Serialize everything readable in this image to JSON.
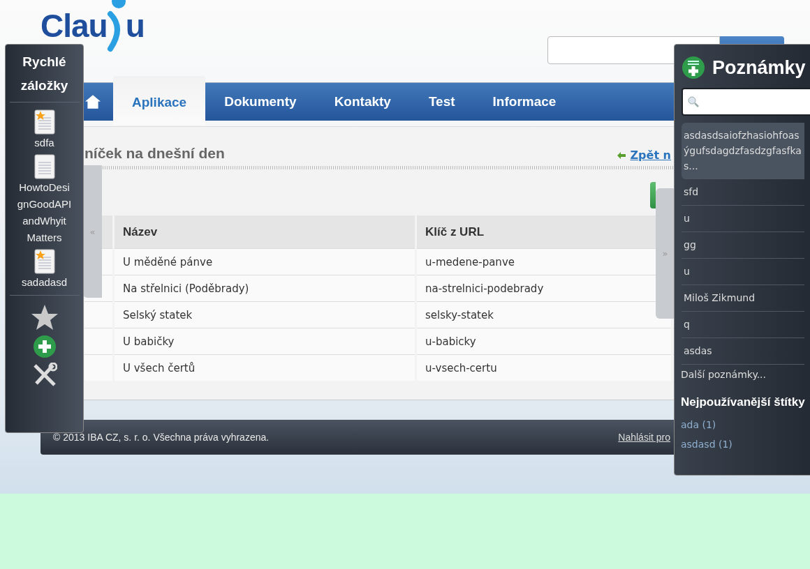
{
  "logo": {
    "text_1": "Clau",
    "text_2": "u"
  },
  "nav": {
    "tabs": [
      {
        "kind": "home",
        "selected": false
      },
      {
        "kind": "text",
        "label": "Aplikace",
        "selected": true
      },
      {
        "kind": "text",
        "label": "Dokumenty",
        "selected": false
      },
      {
        "kind": "text",
        "label": "Kontakty",
        "selected": false
      },
      {
        "kind": "text",
        "label": "Test",
        "selected": false
      },
      {
        "kind": "text",
        "label": "Informace",
        "selected": false
      }
    ]
  },
  "content": {
    "title": "níček na dnešní den",
    "back_link": "Zpět n",
    "scroll_left": "«",
    "scroll_right": "»",
    "table": {
      "columns": [
        "Název",
        "Klíč z URL"
      ],
      "rows": [
        [
          "U měděné pánve",
          "u-medene-panve"
        ],
        [
          "Na střelnici (Poděbrady)",
          "na-strelnici-podebrady"
        ],
        [
          "Selský statek",
          "selsky-statek"
        ],
        [
          "U babičky",
          "u-babicky"
        ],
        [
          "U všech čertů",
          "u-vsech-certu"
        ]
      ]
    }
  },
  "footer": {
    "copyright": "© 2013 IBA CZ, s. r. o. Všechna práva vyhrazena.",
    "report_link": "Nahlásit pro"
  },
  "quick_bookmarks": {
    "title": "Rychlé záložky",
    "items": [
      {
        "label": "sdfa",
        "starred": true
      },
      {
        "label": "HowtoDesignGoodAPIandWhyit Matters",
        "starred": false
      },
      {
        "label": "sadadasd",
        "starred": true
      }
    ]
  },
  "notes": {
    "title": "Poznámky",
    "items": [
      {
        "text": "asdasdsaiofzhasiohfoasýgufsdagdzfasdzgfasfkas...",
        "selected": true
      },
      {
        "text": "sfd",
        "selected": false
      },
      {
        "text": "u",
        "selected": false
      },
      {
        "text": "gg",
        "selected": false
      },
      {
        "text": "u",
        "selected": false
      },
      {
        "text": "Miloš Zikmund",
        "selected": false
      },
      {
        "text": "q",
        "selected": false
      },
      {
        "text": "asdas",
        "selected": false
      }
    ],
    "more_link": "Další poznámky...",
    "tags_title": "Nejpoužívanější štítky",
    "tags": [
      "ada (1)",
      "asdasd (1)"
    ]
  }
}
